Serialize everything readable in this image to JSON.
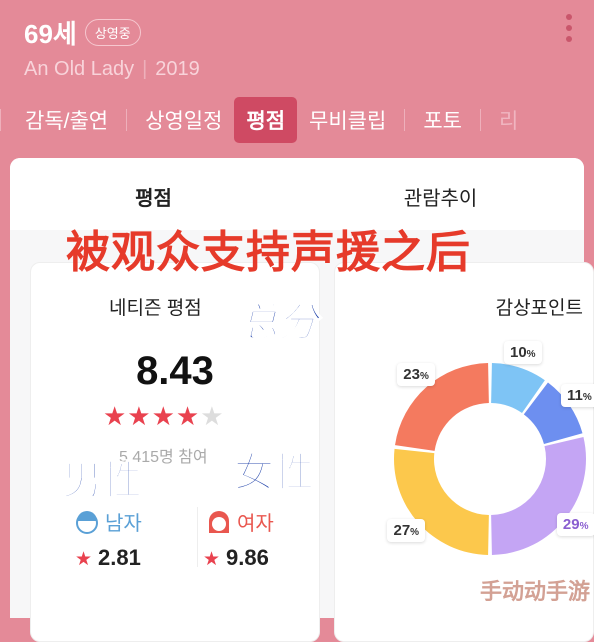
{
  "header": {
    "title": "69세",
    "badge": "상영중",
    "subtitle_en": "An Old Lady",
    "year": "2019"
  },
  "tabs": [
    {
      "label": "감독/출연"
    },
    {
      "label": "상영일정"
    },
    {
      "label": "평점",
      "active": true
    },
    {
      "label": "무비클립"
    },
    {
      "label": "포토"
    },
    {
      "label": "리"
    }
  ],
  "content_tabs": [
    {
      "label": "평점",
      "active": true
    },
    {
      "label": "관람추이"
    }
  ],
  "rating": {
    "title": "네티즌 평점",
    "score": "8.43",
    "stars": 4.2,
    "stars_text": "★★★★",
    "half_star": "★",
    "participants": "5,415명 참여",
    "male": {
      "label": "남자",
      "score": "2.81"
    },
    "female": {
      "label": "여자",
      "score": "9.86"
    },
    "star": "★"
  },
  "points": {
    "title": "감상포인트"
  },
  "chart_data": {
    "type": "pie",
    "donut": true,
    "title": "감상포인트",
    "values": [
      10,
      11,
      29,
      27,
      23
    ],
    "labels": [
      "10%",
      "11%",
      "29%",
      "27%",
      "23%"
    ],
    "colors": [
      "#7ec4f5",
      "#6d8ff0",
      "#c4a5f4",
      "#fcc84c",
      "#f47a5f"
    ]
  },
  "overlay": {
    "headline": "被观众支持声援之后",
    "total": "总分",
    "male": "男性",
    "female": "女性",
    "watermark": "手动动手游"
  },
  "colors": {
    "background": "#e48a98",
    "accent": "#cf4a63",
    "star": "#e9424f"
  }
}
